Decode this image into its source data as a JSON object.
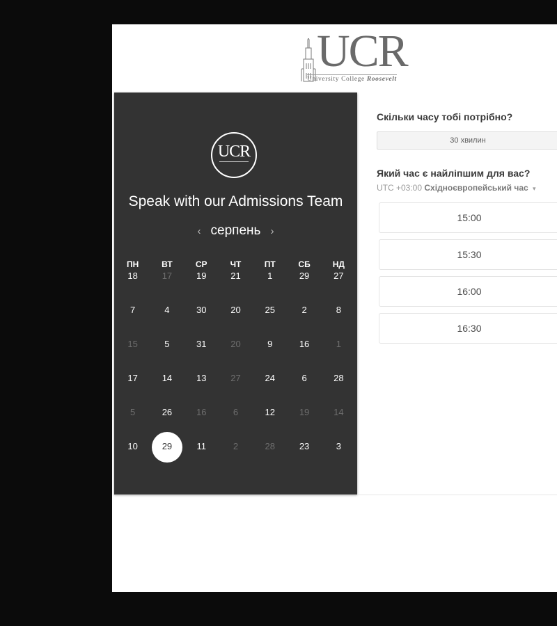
{
  "logo": {
    "letters": "UCR",
    "subtitle": "University College",
    "subtitle_script": "Roosevelt"
  },
  "badge": {
    "letters": "UCR"
  },
  "panel": {
    "title": "Speak with our Admissions Team",
    "month": "серпень",
    "prev_icon": "‹",
    "next_icon": "›"
  },
  "weekdays": [
    "ПН",
    "ВТ",
    "СР",
    "ЧТ",
    "ПТ",
    "СБ",
    "НД"
  ],
  "calendar": [
    [
      {
        "d": "18",
        "off": false
      },
      {
        "d": "17",
        "off": true
      },
      {
        "d": "19",
        "off": false
      },
      {
        "d": "21",
        "off": false
      },
      {
        "d": "1",
        "off": false
      },
      {
        "d": "29",
        "off": false
      },
      {
        "d": "27",
        "off": false
      }
    ],
    [
      {
        "d": "7",
        "off": false
      },
      {
        "d": "4",
        "off": false
      },
      {
        "d": "30",
        "off": false
      },
      {
        "d": "20",
        "off": false
      },
      {
        "d": "25",
        "off": false
      },
      {
        "d": "2",
        "off": false
      },
      {
        "d": "8",
        "off": false
      }
    ],
    [
      {
        "d": "15",
        "off": true
      },
      {
        "d": "5",
        "off": false
      },
      {
        "d": "31",
        "off": false
      },
      {
        "d": "20",
        "off": true
      },
      {
        "d": "9",
        "off": false
      },
      {
        "d": "16",
        "off": false
      },
      {
        "d": "1",
        "off": true
      }
    ],
    [
      {
        "d": "17",
        "off": false
      },
      {
        "d": "14",
        "off": false
      },
      {
        "d": "13",
        "off": false
      },
      {
        "d": "27",
        "off": true
      },
      {
        "d": "24",
        "off": false
      },
      {
        "d": "6",
        "off": false
      },
      {
        "d": "28",
        "off": false
      }
    ],
    [
      {
        "d": "5",
        "off": true
      },
      {
        "d": "26",
        "off": false
      },
      {
        "d": "16",
        "off": true
      },
      {
        "d": "6",
        "off": true
      },
      {
        "d": "12",
        "off": false
      },
      {
        "d": "19",
        "off": true
      },
      {
        "d": "14",
        "off": true
      }
    ],
    [
      {
        "d": "10",
        "off": false
      },
      {
        "d": "29",
        "off": false,
        "selected": true
      },
      {
        "d": "11",
        "off": false
      },
      {
        "d": "2",
        "off": true
      },
      {
        "d": "28",
        "off": true
      },
      {
        "d": "23",
        "off": false
      },
      {
        "d": "3",
        "off": false
      }
    ]
  ],
  "right": {
    "duration_question": "Скільки часу тобі потрібно?",
    "duration_value": "30 хвилин",
    "time_question": "Який час є найліпшим для вас?",
    "tz_offset": "UTC +03:00",
    "tz_name": "Східноєвропейський час",
    "tz_caret": "▾",
    "slots": [
      "15:00",
      "15:30",
      "16:00",
      "16:30"
    ]
  },
  "icons": {
    "logo": "ucr-logo-icon",
    "badge": "ucr-badge-icon",
    "prev": "chevron-left-icon",
    "next": "chevron-right-icon",
    "tz": "caret-down-icon"
  }
}
